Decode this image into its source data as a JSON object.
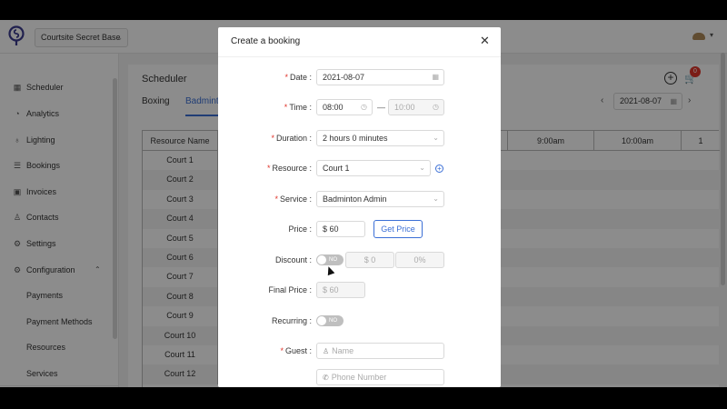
{
  "header": {
    "base_name": "Courtsite Secret Base"
  },
  "sidebar": {
    "items": [
      {
        "label": "Scheduler",
        "icon": "calendar-icon"
      },
      {
        "label": "Analytics",
        "icon": "analytics-icon"
      },
      {
        "label": "Lighting",
        "icon": "bulb-icon"
      },
      {
        "label": "Bookings",
        "icon": "list-icon"
      },
      {
        "label": "Invoices",
        "icon": "invoice-icon"
      },
      {
        "label": "Contacts",
        "icon": "user-icon"
      },
      {
        "label": "Settings",
        "icon": "gear-icon"
      },
      {
        "label": "Configuration",
        "icon": "gear-icon"
      }
    ],
    "sub_items": [
      "Payments",
      "Payment Methods",
      "Resources",
      "Services"
    ]
  },
  "scheduler": {
    "title": "Scheduler",
    "tabs": [
      "Boxing",
      "Badminton"
    ],
    "date": "2021-08-07",
    "cart_count": "0",
    "grid_header": {
      "resource_col": "Resource Name",
      "times": [
        "9:00am",
        "10:00am",
        "1"
      ]
    },
    "rows": [
      "Court 1",
      "Court 2",
      "Court 3",
      "Court 4",
      "Court 5",
      "Court 6",
      "Court 7",
      "Court 8",
      "Court 9",
      "Court 10",
      "Court 11",
      "Court 12"
    ]
  },
  "modal": {
    "title": "Create a booking",
    "date_label": "Date",
    "date_value": "2021-08-07",
    "time_label": "Time",
    "time_start": "08:00",
    "time_sep": "—",
    "time_end": "10:00",
    "duration_label": "Duration",
    "duration_value": "2 hours 0 minutes",
    "resource_label": "Resource",
    "resource_value": "Court 1",
    "service_label": "Service",
    "service_value": "Badminton Admin",
    "price_label": "Price",
    "price_value": "$ 60",
    "get_price_label": "Get Price",
    "discount_label": "Discount",
    "discount_toggle": "NO",
    "discount_amount": "$ 0",
    "discount_percent": "0%",
    "final_price_label": "Final Price",
    "final_price_value": "$ 60",
    "recurring_label": "Recurring",
    "recurring_toggle": "NO",
    "guest_label": "Guest",
    "name_placeholder": "Name",
    "phone_placeholder": "Phone Number"
  },
  "colors": {
    "accent": "#3b6fd6",
    "required": "#e0352b",
    "badge": "#e0352b"
  }
}
